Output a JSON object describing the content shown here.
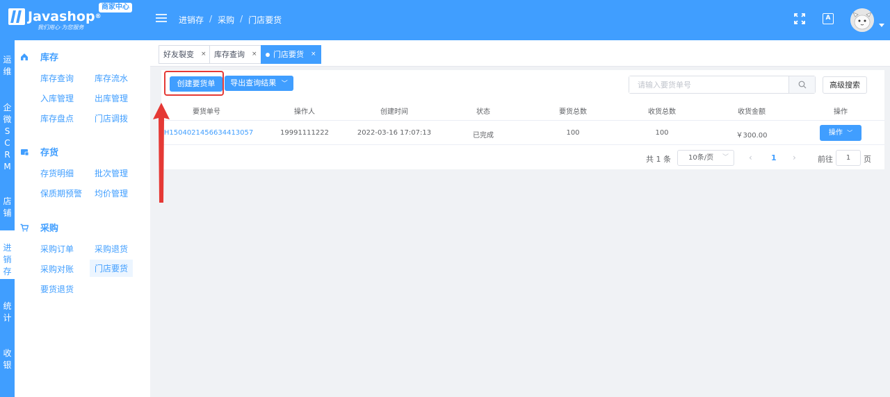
{
  "header": {
    "logo_text": "Javashop",
    "logo_reg": "®",
    "slogan": "我们用心·为您服务",
    "badge": "商家中心",
    "breadcrumb": [
      "进销存",
      "采购",
      "门店要货"
    ],
    "lang_icon_text": "A",
    "icons": [
      "menu-icon",
      "fullscreen-icon",
      "translate-icon",
      "avatar",
      "caret-down-icon"
    ]
  },
  "leftbar": [
    {
      "label": "运维",
      "active": false
    },
    {
      "label": "企微SCRM",
      "active": false
    },
    {
      "label": "店铺",
      "active": false
    },
    {
      "label": "进销存",
      "active": true
    },
    {
      "label": "统计",
      "active": false
    },
    {
      "label": "收银",
      "active": false
    }
  ],
  "sidebar": {
    "sections": [
      {
        "title": "库存",
        "icon": "home-icon",
        "items": [
          "库存查询",
          "库存流水",
          "入库管理",
          "出库管理",
          "库存盘点",
          "门店调拨"
        ]
      },
      {
        "title": "存货",
        "icon": "inventory-icon",
        "items": [
          "存货明细",
          "批次管理",
          "保质期预警",
          "均价管理"
        ]
      },
      {
        "title": "采购",
        "icon": "cart-icon",
        "items": [
          "采购订单",
          "采购退货",
          "采购对账",
          "门店要货",
          "要货退货"
        ]
      }
    ],
    "active_item": "门店要货"
  },
  "tabs": [
    {
      "label": "好友裂变",
      "active": false
    },
    {
      "label": "库存查询",
      "active": false
    },
    {
      "label": "门店要货",
      "active": true
    }
  ],
  "tab_close": "×",
  "toolbar": {
    "create_label": "创建要货单",
    "export_label": "导出查询结果",
    "search_placeholder": "请输入要货单号",
    "advanced_label": "高级搜索"
  },
  "table": {
    "columns": [
      "要货单号",
      "操作人",
      "创建时间",
      "状态",
      "要货总数",
      "收货总数",
      "收货金额",
      "操作"
    ],
    "rows": [
      {
        "order_no": "YH1504021456634413057",
        "operator": "19991111222",
        "created": "2022-03-16 17:07:13",
        "status": "已完成",
        "request_total": "100",
        "received_total": "100",
        "amount": "￥300.00",
        "action": "操作"
      }
    ]
  },
  "pager": {
    "total": "共 1 条",
    "page_size": "10条/页",
    "current": "1",
    "goto_label": "前往",
    "goto_value": "1",
    "page_unit": "页"
  },
  "colors": {
    "primary": "#409eff",
    "highlight": "#e53935",
    "background": "#f0f2f5"
  }
}
